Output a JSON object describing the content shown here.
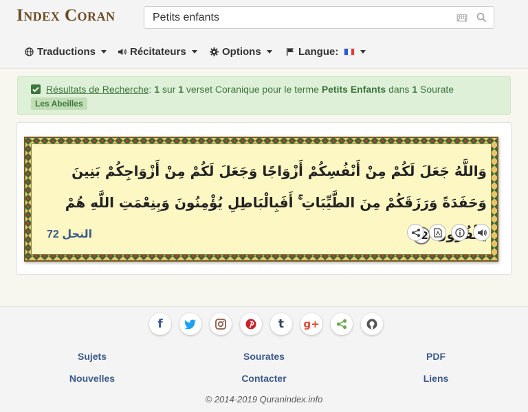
{
  "header": {
    "logo": "Index Coran",
    "search": {
      "value": "Petits enfants"
    }
  },
  "nav": {
    "items": [
      {
        "label": "Traductions"
      },
      {
        "label": "Récitateurs"
      },
      {
        "label": "Options"
      },
      {
        "label": "Langue:"
      }
    ]
  },
  "alert": {
    "link": "Résultats de Recherche",
    "colon": ":",
    "count": "1",
    "sur": "sur",
    "verse_count": "1",
    "verse_text": "verset Coranique pour le terme",
    "term": "Petits Enfants",
    "dans": "dans",
    "surah_count": "1",
    "surah_word": "Sourate",
    "badge": "Les Abeilles"
  },
  "verse": {
    "text": "وَاللَّهُ جَعَلَ لَكُمْ مِنْ أَنْفُسِكُمْ أَزْوَاجًا وَجَعَلَ لَكُمْ مِنْ أَزْوَاجِكُمْ بَنِينَ وَحَفَدَةً وَرَزَقَكُمْ مِنَ الطَّيِّبَاتِ ۚ أَفَبِالْبَاطِلِ يُؤْمِنُونَ وَبِنِعْمَتِ اللَّهِ هُمْ يَكْفُرُونَ",
    "number": "72",
    "reference": "النحل 72"
  },
  "footer": {
    "links": [
      "Sujets",
      "Sourates",
      "PDF",
      "Nouvelles",
      "Contacter",
      "Liens"
    ],
    "copyright": "© 2014-2019 Quranindex.info"
  },
  "social": {
    "facebook_glyph": "f",
    "tumblr_glyph": "t",
    "googleplus_glyph": "g+"
  },
  "colors": {
    "accent": "#3b5a8a",
    "logo": "#6b4a24",
    "alert_bg": "#dff0d8",
    "alert_text": "#3c763d",
    "verse_bg": "#fdf7c4"
  }
}
